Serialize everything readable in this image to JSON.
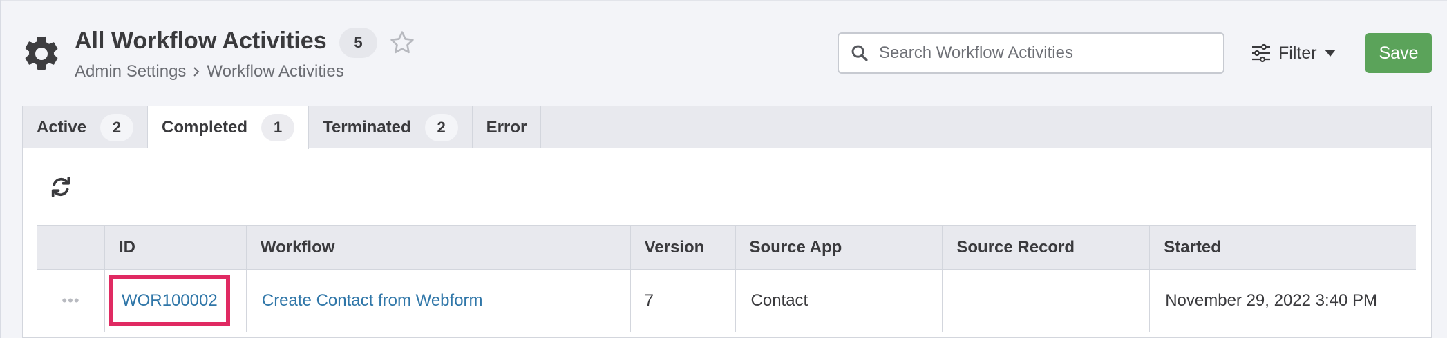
{
  "header": {
    "title": "All Workflow Activities",
    "count": "5",
    "breadcrumb": [
      "Admin Settings",
      "Workflow Activities"
    ],
    "search_placeholder": "Search Workflow Activities",
    "filter_label": "Filter",
    "save_label": "Save"
  },
  "tabs": [
    {
      "label": "Active",
      "count": "2"
    },
    {
      "label": "Completed",
      "count": "1"
    },
    {
      "label": "Terminated",
      "count": "2"
    },
    {
      "label": "Error"
    }
  ],
  "active_tab": "Completed",
  "table": {
    "columns": [
      "ID",
      "Workflow",
      "Version",
      "Source App",
      "Source Record",
      "Started"
    ],
    "rows": [
      {
        "menu": "•••",
        "id": "WOR100002",
        "workflow": "Create Contact from Webform",
        "version": "7",
        "source_app": "Contact",
        "source_record": "",
        "started": "November 29, 2022 3:40 PM"
      }
    ]
  },
  "colors": {
    "accent_link": "#2f76a8",
    "save_button": "#5ba35a",
    "highlight": "#e02a62"
  },
  "icons": {
    "page": "gear-icon",
    "favorite": "star-icon",
    "search": "search-icon",
    "filter": "sliders-icon",
    "refresh": "refresh-icon"
  }
}
